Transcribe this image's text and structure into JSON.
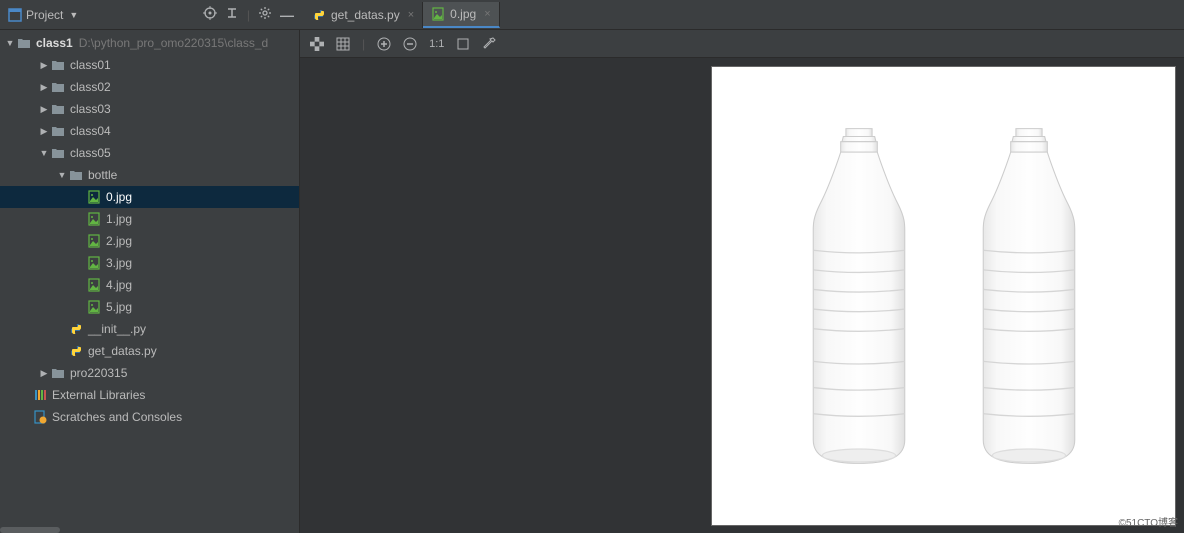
{
  "header": {
    "project_label": "Project",
    "tabs": [
      {
        "label": "get_datas.py",
        "active": false,
        "icon": "python"
      },
      {
        "label": "0.jpg",
        "active": true,
        "icon": "image"
      }
    ]
  },
  "tree": {
    "root": {
      "label": "class1",
      "path": "D:\\python_pro_omo220315\\class_d"
    },
    "items": [
      {
        "indent": 1,
        "arrow": "▶",
        "icon": "folder",
        "label": "class01"
      },
      {
        "indent": 1,
        "arrow": "▶",
        "icon": "folder",
        "label": "class02"
      },
      {
        "indent": 1,
        "arrow": "▶",
        "icon": "folder",
        "label": "class03"
      },
      {
        "indent": 1,
        "arrow": "▶",
        "icon": "folder",
        "label": "class04"
      },
      {
        "indent": 1,
        "arrow": "▼",
        "icon": "folder",
        "label": "class05"
      },
      {
        "indent": 2,
        "arrow": "▼",
        "icon": "folder",
        "label": "bottle"
      },
      {
        "indent": 3,
        "arrow": "",
        "icon": "file",
        "label": "0.jpg",
        "selected": true
      },
      {
        "indent": 3,
        "arrow": "",
        "icon": "file",
        "label": "1.jpg"
      },
      {
        "indent": 3,
        "arrow": "",
        "icon": "file",
        "label": "2.jpg"
      },
      {
        "indent": 3,
        "arrow": "",
        "icon": "file",
        "label": "3.jpg"
      },
      {
        "indent": 3,
        "arrow": "",
        "icon": "file",
        "label": "4.jpg"
      },
      {
        "indent": 3,
        "arrow": "",
        "icon": "file",
        "label": "5.jpg"
      },
      {
        "indent": 2,
        "arrow": "",
        "icon": "python",
        "label": "__init__.py"
      },
      {
        "indent": 2,
        "arrow": "",
        "icon": "python",
        "label": "get_datas.py"
      },
      {
        "indent": 1,
        "arrow": "▶",
        "icon": "folder",
        "label": "pro220315"
      },
      {
        "indent": 0,
        "arrow": "",
        "icon": "lib",
        "label": "External Libraries"
      },
      {
        "indent": 0,
        "arrow": "",
        "icon": "scratch",
        "label": "Scratches and Consoles"
      }
    ]
  },
  "viewer": {
    "zoom_label": "1:1"
  },
  "watermark": "©51CTO博客"
}
